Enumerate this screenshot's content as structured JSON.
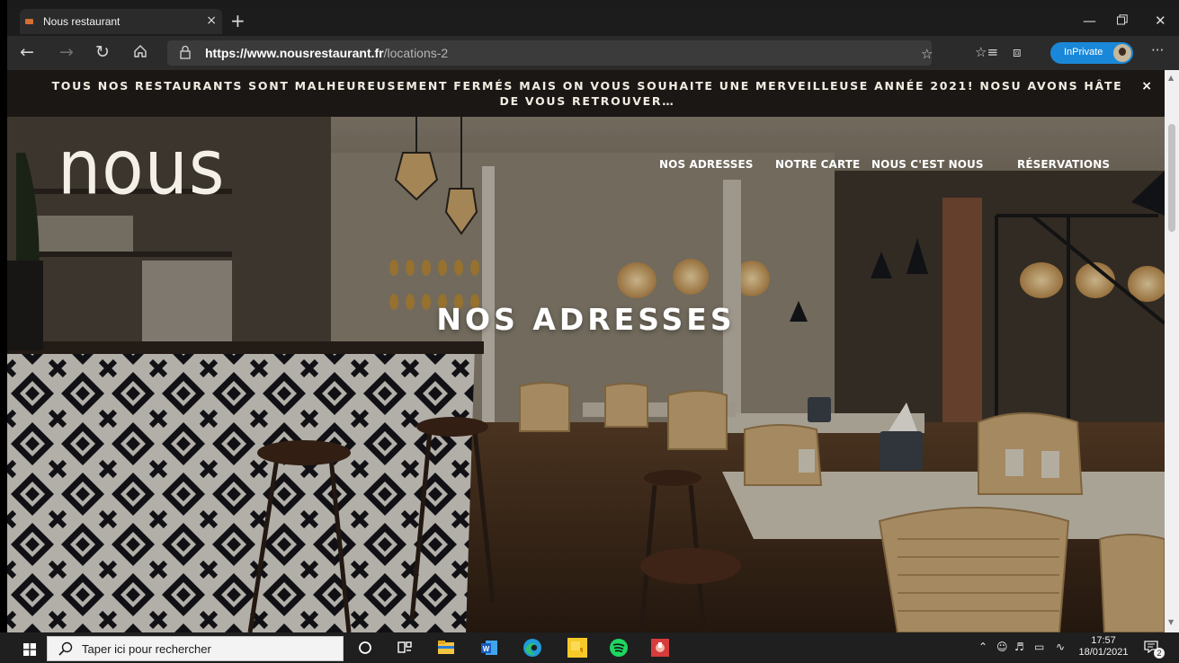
{
  "browser": {
    "tab_title": "Nous restaurant",
    "tab_close": "×",
    "new_tab": "+",
    "url_scheme": "https://",
    "url_host": "www.nousrestaurant.fr",
    "url_path": "/locations-2",
    "inprivate_label": "InPrivate",
    "accent_color": "#1a88d8"
  },
  "notice": {
    "text": "TOUS NOS RESTAURANTS SONT MALHEUREUSEMENT FERMÉS MAIS ON VOUS SOUHAITE UNE MERVEILLEUSE ANNÉE 2021! NOSU AVONS HÂTE DE VOUS RETROUVER…",
    "close": "×"
  },
  "site": {
    "logo": "nous",
    "nav": [
      "NOS ADRESSES",
      "NOTRE CARTE",
      "NOUS C'EST NOUS",
      "RÉSERVATIONS"
    ],
    "hero_title": "NOS ADRESSES"
  },
  "taskbar": {
    "search_placeholder": "Taper ici pour rechercher",
    "time": "17:57",
    "date": "18/01/2021",
    "notification_count": "2",
    "apps": [
      "task-view-icon",
      "file-explorer-icon",
      "word-icon",
      "edge-icon",
      "sticky-notes-icon",
      "spotify-icon",
      "media-app-icon"
    ]
  }
}
